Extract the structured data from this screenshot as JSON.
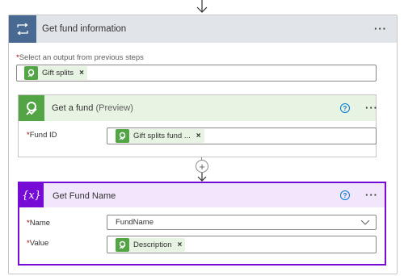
{
  "colors": {
    "loop_tile": "#486991",
    "connector_green": "#52a445",
    "variable_purple": "#770bd6",
    "required": "#a80000",
    "help_blue": "#0078d4"
  },
  "outer_step": {
    "icon": "loop-icon",
    "title": "Get fund information",
    "menu": "···",
    "select_output_label": "Select an output from previous steps",
    "required_mark": "*",
    "token": {
      "icon": "connector-icon",
      "label": "Gift splits",
      "remove": "×"
    }
  },
  "get_a_fund": {
    "icon": "connector-icon",
    "title": "Get a fund",
    "title_suffix": "(Preview)",
    "help": "?",
    "menu": "···",
    "fund_id": {
      "required_mark": "*",
      "label": "Fund ID",
      "token": {
        "icon": "connector-icon",
        "label": "Gift splits fund ...",
        "remove": "×"
      }
    }
  },
  "connector": {
    "add_icon": "plus-icon",
    "add_glyph": "+"
  },
  "get_fund_name": {
    "icon": "variable-icon",
    "icon_glyph": "{x}",
    "title": "Get Fund Name",
    "help": "?",
    "menu": "···",
    "name": {
      "required_mark": "*",
      "label": "Name",
      "value": "FundName"
    },
    "value": {
      "required_mark": "*",
      "label": "Value",
      "token": {
        "icon": "connector-icon",
        "label": "Description",
        "remove": "×"
      }
    }
  }
}
